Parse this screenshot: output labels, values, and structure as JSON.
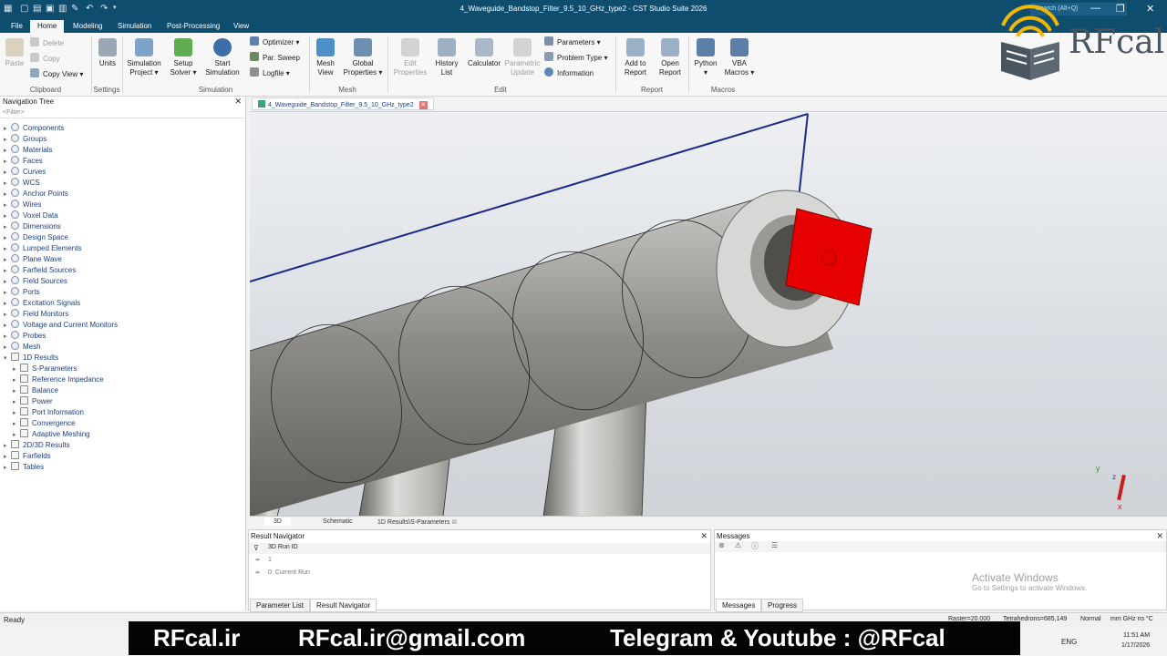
{
  "app": {
    "title": "4_Waveguide_Bandstop_Filter_9.5_10_GHz_type2 - CST Studio Suite 2026",
    "search_placeholder": "Search (Alt+Q)"
  },
  "menu": [
    "File",
    "Home",
    "Modeling",
    "Simulation",
    "Post-Processing",
    "View"
  ],
  "ribbon": {
    "clipboard": {
      "paste": "Paste",
      "delete": "Delete",
      "copy": "Copy",
      "copy_view": "Copy View",
      "group": "Clipboard"
    },
    "settings": {
      "units": "Units",
      "group": "Settings"
    },
    "simulation": {
      "simulation_project": "Simulation Project",
      "setup_solver": "Setup Solver",
      "start_simulation": "Start Simulation",
      "optimizer": "Optimizer",
      "par_sweep": "Par. Sweep",
      "logfile": "Logfile",
      "group": "Simulation"
    },
    "mesh": {
      "mesh_view": "Mesh View",
      "global_properties": "Global Properties",
      "group": "Mesh"
    },
    "edit": {
      "edit_properties": "Edit Properties",
      "history_list": "History List",
      "calculator": "Calculator",
      "parametric_update": "Parametric Update",
      "parameters": "Parameters",
      "problem_type": "Problem Type",
      "information": "Information",
      "group": "Edit"
    },
    "report": {
      "add_to_report": "Add to Report",
      "open_report": "Open Report",
      "group": "Report"
    },
    "macros": {
      "python": "Python",
      "vba_macros": "VBA Macros",
      "group": "Macros"
    }
  },
  "navtree": {
    "title": "Navigation Tree",
    "filter": "<Filter>",
    "items": [
      {
        "label": "Components",
        "level": 0,
        "icon": "node"
      },
      {
        "label": "Groups",
        "level": 0,
        "icon": "node"
      },
      {
        "label": "Materials",
        "level": 0,
        "icon": "node"
      },
      {
        "label": "Faces",
        "level": 0,
        "icon": "node"
      },
      {
        "label": "Curves",
        "level": 0,
        "icon": "node"
      },
      {
        "label": "WCS",
        "level": 0,
        "icon": "node"
      },
      {
        "label": "Anchor Points",
        "level": 0,
        "icon": "node"
      },
      {
        "label": "Wires",
        "level": 0,
        "icon": "node"
      },
      {
        "label": "Voxel Data",
        "level": 0,
        "icon": "node"
      },
      {
        "label": "Dimensions",
        "level": 0,
        "icon": "node"
      },
      {
        "label": "Design Space",
        "level": 0,
        "icon": "node"
      },
      {
        "label": "Lumped Elements",
        "level": 0,
        "icon": "node"
      },
      {
        "label": "Plane Wave",
        "level": 0,
        "icon": "node"
      },
      {
        "label": "Farfield Sources",
        "level": 0,
        "icon": "node"
      },
      {
        "label": "Field Sources",
        "level": 0,
        "icon": "node"
      },
      {
        "label": "Ports",
        "level": 0,
        "icon": "node"
      },
      {
        "label": "Excitation Signals",
        "level": 0,
        "icon": "node"
      },
      {
        "label": "Field Monitors",
        "level": 0,
        "icon": "node"
      },
      {
        "label": "Voltage and Current Monitors",
        "level": 0,
        "icon": "node"
      },
      {
        "label": "Probes",
        "level": 0,
        "icon": "node"
      },
      {
        "label": "Mesh",
        "level": 0,
        "icon": "node"
      },
      {
        "label": "1D Results",
        "level": 0,
        "icon": "fold",
        "expanded": true
      },
      {
        "label": "S-Parameters",
        "level": 1,
        "icon": "fold"
      },
      {
        "label": "Reference Impedance",
        "level": 1,
        "icon": "fold"
      },
      {
        "label": "Balance",
        "level": 1,
        "icon": "fold"
      },
      {
        "label": "Power",
        "level": 1,
        "icon": "fold"
      },
      {
        "label": "Port Information",
        "level": 1,
        "icon": "fold"
      },
      {
        "label": "Convergence",
        "level": 1,
        "icon": "fold"
      },
      {
        "label": "Adaptive Meshing",
        "level": 1,
        "icon": "fold"
      },
      {
        "label": "2D/3D Results",
        "level": 0,
        "icon": "fold"
      },
      {
        "label": "Farfields",
        "level": 0,
        "icon": "fold"
      },
      {
        "label": "Tables",
        "level": 0,
        "icon": "fold"
      }
    ]
  },
  "document_tab": "4_Waveguide_Bandstop_Filter_9.5_10_GHz_type2",
  "view_tabs": [
    "3D",
    "Schematic",
    "1D Results\\S-Parameters"
  ],
  "axes": {
    "y": "y",
    "z": "z",
    "x": "x"
  },
  "result_navigator": {
    "title": "Result Navigator",
    "column": "3D Run ID",
    "rows": [
      "1",
      "0: Current Run"
    ],
    "tabs": [
      "Parameter List",
      "Result Navigator"
    ]
  },
  "messages": {
    "title": "Messages",
    "tabs": [
      "Messages",
      "Progress"
    ],
    "activate_title": "Activate Windows",
    "activate_sub": "Go to Settings to activate Windows."
  },
  "status": {
    "left": "Ready",
    "raster": "Raster=20.000",
    "tetra": "Tetrahedrons=685,149",
    "mode": "Normal",
    "units": "mm  GHz  ns  °C"
  },
  "taskbar": {
    "lang": "ENG",
    "time": "11:51 AM",
    "date": "1/17/2026"
  },
  "overlay": {
    "site": "RFcal.ir",
    "email": "RFcal.ir@gmail.com",
    "social": "Telegram & Youtube : @RFcal",
    "logo_text": "RFcal"
  },
  "colors": {
    "titlebar": "#0f4d6f",
    "port": "#e60000",
    "accent": "#1f3f7a"
  }
}
